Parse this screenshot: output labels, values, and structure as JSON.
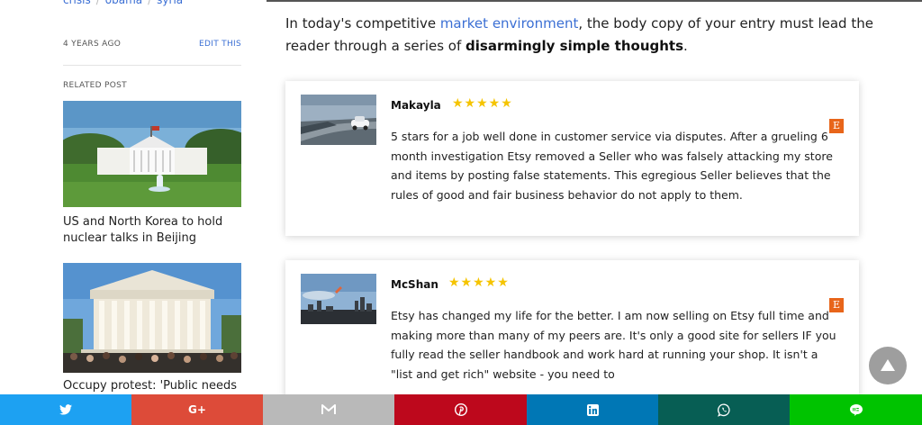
{
  "sidebar": {
    "tags": [
      "crisis",
      "obama",
      "syria"
    ],
    "post_age": "4 YEARS AGO",
    "edit_label": "EDIT THIS",
    "related_label": "RELATED POST",
    "related": [
      {
        "title": "US and North Korea to hold nuclear talks in Beijing"
      },
      {
        "title": "Occupy protest: 'Public needs"
      }
    ]
  },
  "intro": {
    "text_before": "In today's competitive ",
    "link": "market environment",
    "text_middle": ", the body copy of your entry must lead the reader through a series of ",
    "bold": "disarmingly simple thoughts",
    "text_end": "."
  },
  "reviews": [
    {
      "name": "Makayla",
      "rating": 5,
      "stars": "★★★★★",
      "source_badge": "E",
      "text": "5 stars for a job well done in customer service via disputes. After a grueling 6 month investigation Etsy removed a Seller who was falsely attacking my store and items by posting false statements. This egregious Seller believes that the rules of good and fair business behavior do not apply to them."
    },
    {
      "name": "McShan",
      "rating": 5,
      "stars": "★★★★★",
      "source_badge": "E",
      "text": "Etsy has changed my life for the better. I am now selling on Etsy full time and making more than many of my peers are. It's only a good site for sellers IF you fully read the seller handbook and work hard at running your shop. It isn't a \"list and get rich\" website - you need to"
    }
  ],
  "share": {
    "googleplus_label": "G+",
    "items": [
      {
        "icon": "twitter-icon",
        "color": "#1da1f2"
      },
      {
        "icon": "google-plus-icon",
        "color": "#dd4b39"
      },
      {
        "icon": "gmail-icon",
        "color": "#b9b9b9"
      },
      {
        "icon": "pinterest-icon",
        "color": "#bd081c"
      },
      {
        "icon": "linkedin-icon",
        "color": "#0077b5"
      },
      {
        "icon": "whatsapp-icon",
        "color": "#075e54"
      },
      {
        "icon": "line-icon",
        "color": "#00c300"
      }
    ]
  },
  "colors": {
    "accent_link": "#3b6fd4",
    "star": "#f5c400",
    "etsy": "#e8651a"
  }
}
